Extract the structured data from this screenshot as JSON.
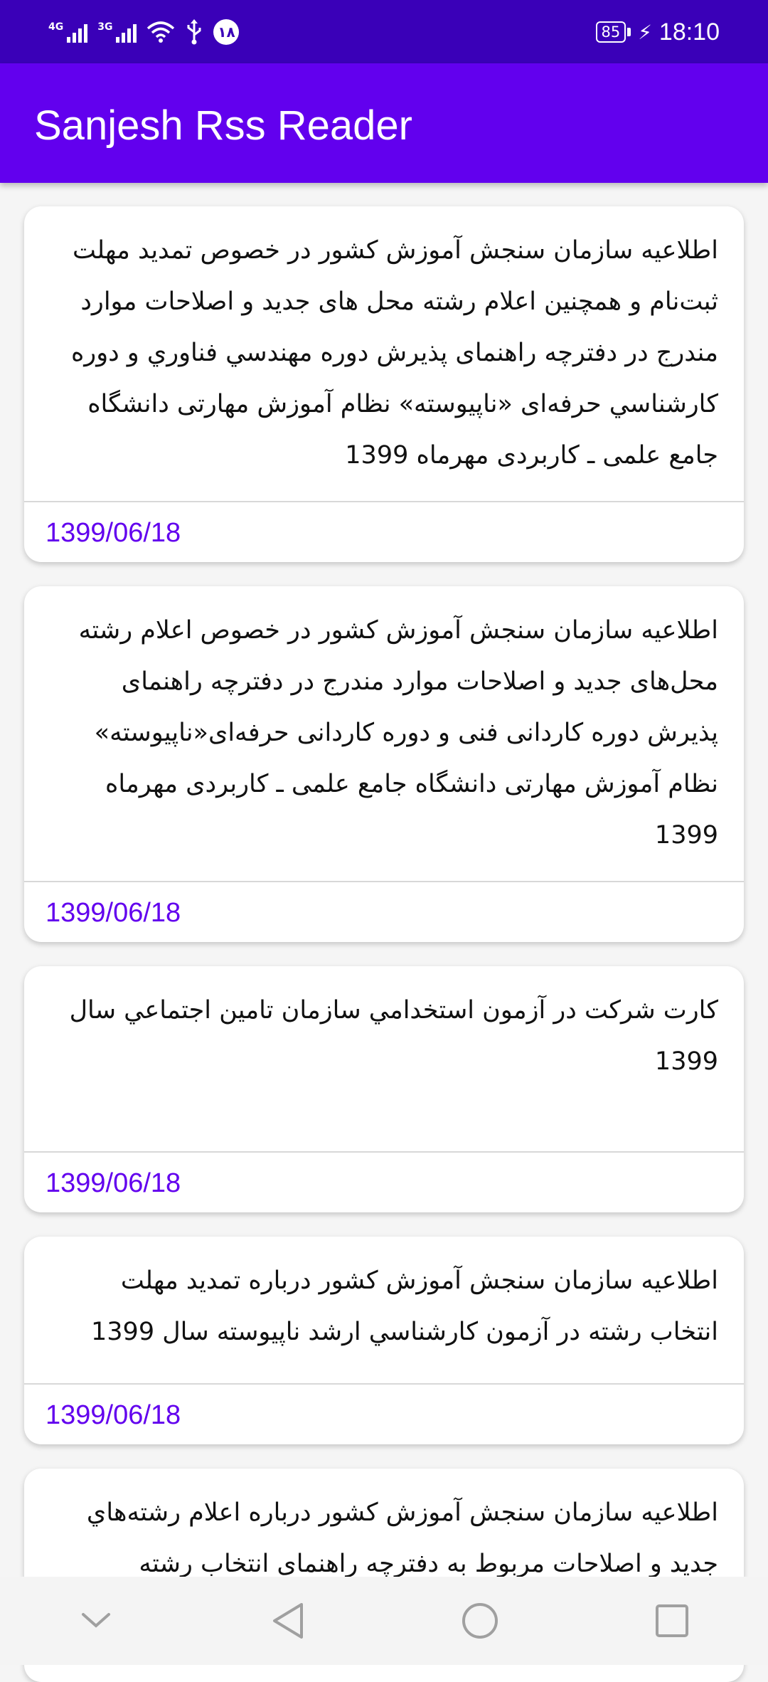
{
  "status_bar": {
    "network_1": "4G",
    "network_2": "3G",
    "notification_badge": "۱۸",
    "battery_level": "85",
    "time": "18:10"
  },
  "app_bar": {
    "title": "Sanjesh Rss Reader"
  },
  "feed": {
    "items": [
      {
        "title": "اطلاعيه سازمان سنجش آموزش كشور در خصوص تمديد مهلت ثبت‌نام  و همچنين اعلام رشته محل های جديد و اصلاحات موارد مندرج در دفترچه راهنمای پذيرش دوره مهندسي فناوري و دوره كارشناسي حرفه‌ای «ناپيوسته» نظام آموزش مهارتی دانشگاه جامع علمی ـ كاربردی مهرماه 1399",
        "date": "1399/06/18"
      },
      {
        "title": "اطلاعيه سازمان سنجش آموزش كشور در خصوص اعلام رشته محل‌های جديد و اصلاحات موارد مندرج در دفترچه راهنمای پذيرش دوره كاردانی فنی و دوره كاردانی حرفه‌ای«ناپيوسته» نظام آموزش مهارتی دانشگاه جامع علمی ـ كاربردی مهرماه 1399",
        "date": "1399/06/18"
      },
      {
        "title": "كارت شركت در آزمون استخدامي سازمان تامين اجتماعي سال 1399",
        "date": "1399/06/18"
      },
      {
        "title": "اطلاعيه سازمان سنجش آموزش كشور درباره تمديد مهلت انتخاب رشته در آزمون كارشناسي ارشد ناپيوسته سال 1399",
        "date": "1399/06/18"
      },
      {
        "title": "اطلاعيه سازمان سنجش آموزش كشور درباره اعلام رشته‌هاي جديد و اصلاحات مربوط به دفترچه راهنمای انتخاب رشته",
        "date": ""
      }
    ]
  },
  "nav_bar": {
    "buttons": [
      "hide-keyboard",
      "back",
      "home",
      "recents"
    ]
  },
  "colors": {
    "status_bar": "#3a00b8",
    "app_bar": "#6200ee",
    "accent": "#6200ee",
    "background": "#f5f5f5"
  }
}
